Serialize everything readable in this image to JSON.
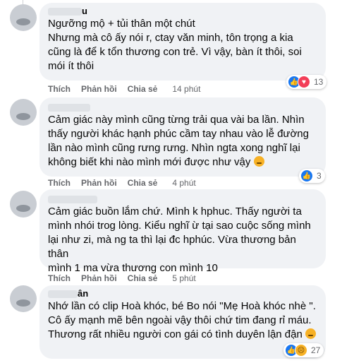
{
  "comments": [
    {
      "name": "u",
      "lines": [
        "Ngưỡng mộ + tủi thân một chút",
        "Nhưng mà cô ấy nói r, ctay văn minh, tôn trọng a kia",
        "cũng là để k tổn thương con trẻ. Vì vậy, bàn ít thôi, soi",
        "mói ít thôi"
      ],
      "like": "Thích",
      "reply": "Phản hồi",
      "share": "Chia sẻ",
      "time": "14 phút",
      "reaction_count": "13"
    },
    {
      "name": "",
      "lines": [
        "Cảm giác này mình cũng từng trải qua vài ba lần. Nhìn",
        "thấy người khác hạnh phúc cầm tay nhau vào lễ đường",
        "lần nào mình cũng rưng rưng. Nhìn ngta xong nghĩ lại",
        "không biết khi nào mình mới được như vậy"
      ],
      "like": "Thích",
      "reply": "Phản hồi",
      "share": "Chia sẻ",
      "time": "4 phút",
      "reaction_count": "3"
    },
    {
      "name": "",
      "lines": [
        "Cảm giác buồn lắm chứ. Mình k hphuc. Thấy người ta",
        "mình nhói trog lòng. Kiểu nghĩ ừ tại sao cuộc sống mình",
        "lại như zi, mà ng ta thì lại đc hphúc. Vừa thương bản thân",
        "mình 1 ma vừa thương con mình 10"
      ],
      "like": "Thích",
      "reply": "Phản hồi",
      "share": "Chia sẻ",
      "time": "5 phút"
    },
    {
      "name": "ân",
      "lines": [
        "Nhớ lần có clip Hoà khóc, bé Bo nói \"Mẹ Hoà khóc nhè \".",
        "Cô ấy mạnh mẽ bên ngoài vậy thôi chứ tim đang rỉ máu.",
        "Thương rất nhiều người con gái có tình duyên lận đận"
      ],
      "reaction_count": "27"
    }
  ],
  "icons": {
    "like": "like-reaction-icon",
    "heart": "heart-reaction-icon",
    "care": "care-reaction-icon",
    "sad": "sad-emoji-icon"
  },
  "colors": {
    "bubble": "#f0f2f5",
    "meta": "#65676b",
    "like_blue": "#1877f2"
  }
}
